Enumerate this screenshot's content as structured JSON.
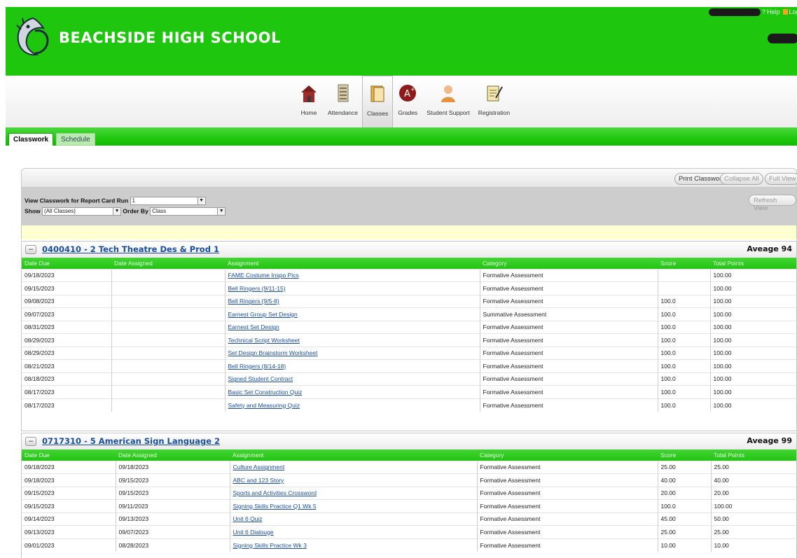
{
  "header": {
    "school_name": "BEACHSIDE HIGH SCHOOL",
    "help_label": "Help",
    "logout_label": "Logo"
  },
  "nav": {
    "items": [
      {
        "label": "Home",
        "icon": "home-icon",
        "active": false
      },
      {
        "label": "Attendance",
        "icon": "attendance-icon",
        "active": false
      },
      {
        "label": "Classes",
        "icon": "classes-icon",
        "active": true
      },
      {
        "label": "Grades",
        "icon": "grades-icon",
        "active": false
      },
      {
        "label": "Student Support",
        "icon": "student-support-icon",
        "active": false
      },
      {
        "label": "Registration",
        "icon": "registration-icon",
        "active": false
      }
    ]
  },
  "tabs": {
    "classwork": "Classwork",
    "schedule": "Schedule"
  },
  "toolbar": {
    "print_label": "Print Classwork",
    "collapse_label": "Collapse All",
    "full_label": "Full View",
    "refresh_label": "Refresh View"
  },
  "filters": {
    "report_run_label": "View Classwork for Report Card Run",
    "report_run_value": "1",
    "show_label": "Show",
    "show_value": "(All Classes)",
    "order_label": "Order By",
    "order_value": "Class"
  },
  "colors": {
    "brand_green": "#1ec70e",
    "link_blue": "#1a4fa0",
    "notice_yellow": "#ffffd2"
  },
  "sections": [
    {
      "title": "0400410 - 2 Tech Theatre Des & Prod 1",
      "average": "Aveage 94",
      "columns": [
        "Date Due",
        "Date Assigned",
        "Assignment",
        "Category",
        "Score",
        "Total Points"
      ],
      "rows": [
        {
          "due": "09/18/2023",
          "assigned": "",
          "assignment": "FAME Costume Inspo Pics",
          "category": "Formative Assessment",
          "score": "",
          "total": "100.00"
        },
        {
          "due": "09/15/2023",
          "assigned": "",
          "assignment": "Bell Ringers (9/11-15)",
          "category": "Formative Assessment",
          "score": "",
          "total": "100.00"
        },
        {
          "due": "09/08/2023",
          "assigned": "",
          "assignment": "Bell Ringers (9/5-8)",
          "category": "Formative Assessment",
          "score": "100.0",
          "total": "100.00"
        },
        {
          "due": "09/07/2023",
          "assigned": "",
          "assignment": "Earnest Group Set Design",
          "category": "Summative Assessment",
          "score": "100.0",
          "total": "100.00"
        },
        {
          "due": "08/31/2023",
          "assigned": "",
          "assignment": "Earnest Set Design",
          "category": "Formative Assessment",
          "score": "100.0",
          "total": "100.00"
        },
        {
          "due": "08/29/2023",
          "assigned": "",
          "assignment": "Technical Script Worksheet",
          "category": "Formative Assessment",
          "score": "100.0",
          "total": "100.00"
        },
        {
          "due": "08/29/2023",
          "assigned": "",
          "assignment": "Set Design Brainstorm Worksheet",
          "category": "Formative Assessment",
          "score": "100.0",
          "total": "100.00"
        },
        {
          "due": "08/21/2023",
          "assigned": "",
          "assignment": "Bell Ringers (8/14-18)",
          "category": "Formative Assessment",
          "score": "100.0",
          "total": "100.00"
        },
        {
          "due": "08/18/2023",
          "assigned": "",
          "assignment": "Signed Student Contract",
          "category": "Formative Assessment",
          "score": "100.0",
          "total": "100.00"
        },
        {
          "due": "08/17/2023",
          "assigned": "",
          "assignment": "Basic Set Construction Quiz",
          "category": "Formative Assessment",
          "score": "100.0",
          "total": "100.00"
        },
        {
          "due": "08/17/2023",
          "assigned": "",
          "assignment": "Safety and Measuring Quiz",
          "category": "Formative Assessment",
          "score": "100.0",
          "total": "100.00"
        }
      ]
    },
    {
      "title": "0717310 - 5 American Sign Language 2",
      "average": "Aveage 99",
      "columns": [
        "Date Due",
        "Date Assigned",
        "Assignment",
        "Category",
        "Score",
        "Total Points"
      ],
      "rows": [
        {
          "due": "09/18/2023",
          "assigned": "09/18/2023",
          "assignment": "Culture Assignment",
          "category": "Formative Assessment",
          "score": "25.00",
          "total": "25.00"
        },
        {
          "due": "09/18/2023",
          "assigned": "09/15/2023",
          "assignment": "ABC and 123 Story",
          "category": "Formative Assessment",
          "score": "40.00",
          "total": "40.00"
        },
        {
          "due": "09/15/2023",
          "assigned": "09/15/2023",
          "assignment": "Sports and Activities Crossword",
          "category": "Formative Assessment",
          "score": "20.00",
          "total": "20.00"
        },
        {
          "due": "09/15/2023",
          "assigned": "09/11/2023",
          "assignment": "Signing Skills Practice Q1 Wk 5",
          "category": "Formative Assessment",
          "score": "100.0",
          "total": "100.00"
        },
        {
          "due": "09/14/2023",
          "assigned": "09/13/2023",
          "assignment": "Unit 6 Quiz",
          "category": "Formative Assessment",
          "score": "45.00",
          "total": "50.00"
        },
        {
          "due": "09/13/2023",
          "assigned": "09/07/2023",
          "assignment": "Unit 6 Dialouge",
          "category": "Formative Assessment",
          "score": "25.00",
          "total": "25.00"
        },
        {
          "due": "09/01/2023",
          "assigned": "08/28/2023",
          "assignment": "Signing Skills Practice Wk 3",
          "category": "Formative Assessment",
          "score": "10.00",
          "total": "10.00"
        }
      ]
    }
  ]
}
